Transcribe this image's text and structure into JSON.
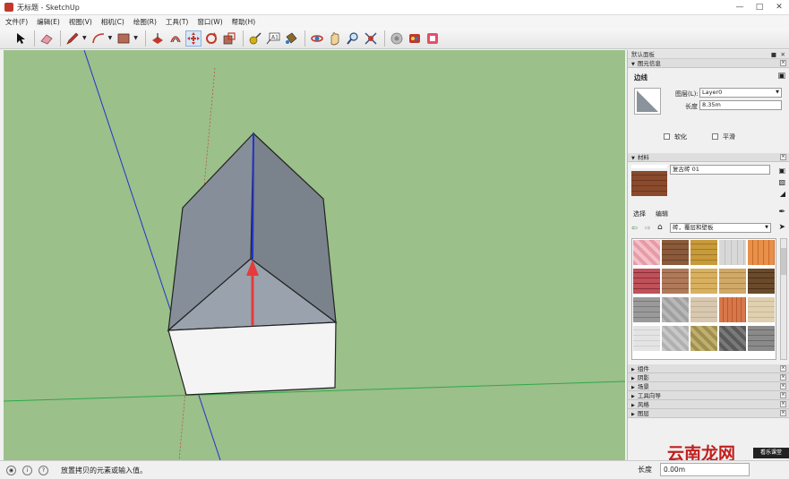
{
  "window": {
    "title": "无标题 - SketchUp"
  },
  "menu": [
    "文件(F)",
    "编辑(E)",
    "视图(V)",
    "相机(C)",
    "绘图(R)",
    "工具(T)",
    "窗口(W)",
    "帮助(H)"
  ],
  "panel": {
    "title": "默认面板",
    "entity_info": {
      "header": "图元信息",
      "type": "边线",
      "layer_label": "图层(L):",
      "layer_value": "Layer0",
      "length_label": "长度",
      "length_value": "8.35m",
      "soften_label": "软化",
      "smooth_label": "平滑"
    },
    "materials": {
      "header": "材料",
      "material_name": "复古砖 01",
      "tab_select": "选择",
      "tab_edit": "编辑",
      "library": "砖，覆层和壁板"
    },
    "collapsed_sections": [
      "组件",
      "阴影",
      "场景",
      "工具向导",
      "风格",
      "图层"
    ]
  },
  "status": {
    "message": "放置拷贝的元素或输入值。",
    "measure_label": "长度",
    "measure_value": "0.00m"
  },
  "watermark": {
    "text": "云南龙网",
    "badge": "看乐课堂"
  },
  "colors": {
    "viewport": "#9bc08a",
    "red_axis": "#e53b3b",
    "blue_axis": "#2233cc",
    "green_axis": "#2ea84a"
  },
  "icons": [
    "select-arrow-icon",
    "eraser-icon",
    "pencil-icon",
    "arc-icon",
    "shape-icon",
    "push-pull-icon",
    "offset-icon",
    "move-icon",
    "rotate-icon",
    "scale-icon",
    "tape-measure-icon",
    "text-icon",
    "paint-bucket-icon",
    "orbit-icon",
    "pan-icon",
    "zoom-icon",
    "zoom-extents-icon",
    "warehouse-icon",
    "extension-icon",
    "layout-icon"
  ]
}
